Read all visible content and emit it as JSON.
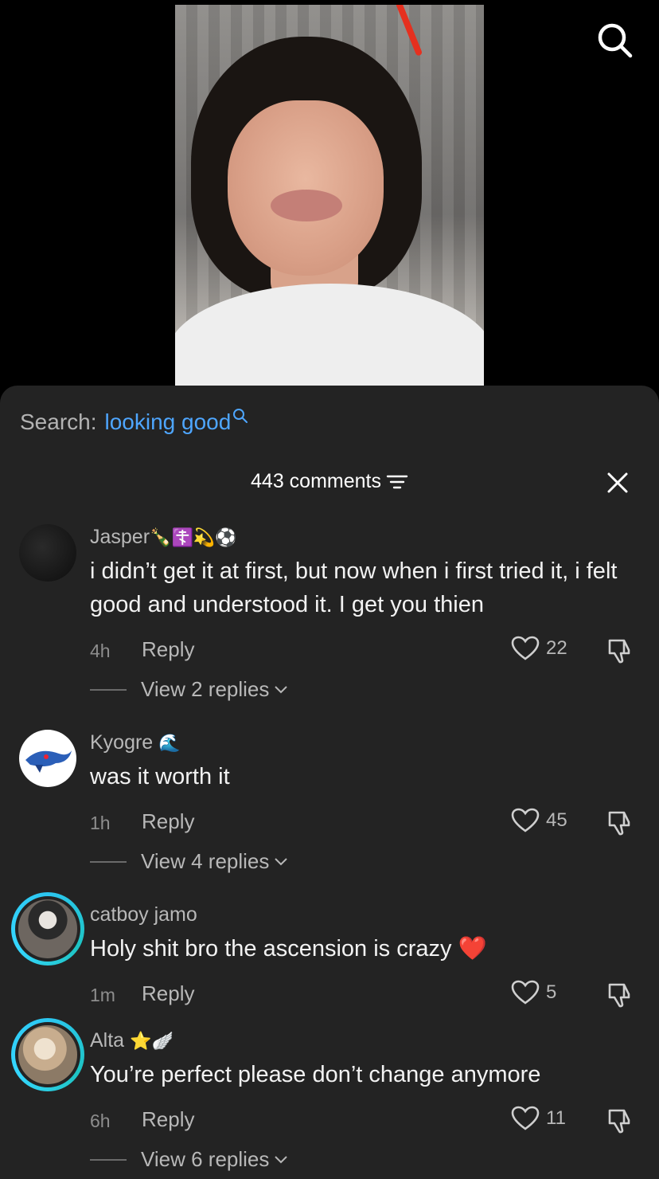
{
  "search": {
    "label": "Search:",
    "term": "looking good"
  },
  "header": {
    "count_text": "443 comments"
  },
  "comments": [
    {
      "username": "Jasper",
      "username_emojis": "🍾☦️💫⚽",
      "text": "i didn’t get it at first, but now when i first tried it, i felt good and understood it. I get you thien",
      "time": "4h",
      "reply": "Reply",
      "likes": "22",
      "view_replies": "View 2 replies"
    },
    {
      "username": "Kyogre",
      "username_emojis": "🌊",
      "text": "was it worth it",
      "time": "1h",
      "reply": "Reply",
      "likes": "45",
      "view_replies": "View 4 replies"
    },
    {
      "username": "catboy jamo",
      "username_emojis": "",
      "text": "Holy shit bro the ascension is crazy ❤️",
      "time": "1m",
      "reply": "Reply",
      "likes": "5"
    },
    {
      "username": "Alta",
      "username_emojis": "⭐🪽",
      "text": "You’re perfect please don’t change anymore",
      "time": "6h",
      "reply": "Reply",
      "likes": "11",
      "view_replies": "View 6 replies"
    }
  ],
  "colors": {
    "accent_link": "#4ea6ff",
    "sheet_bg": "#232323",
    "story_ring": "#2cc6f0"
  }
}
